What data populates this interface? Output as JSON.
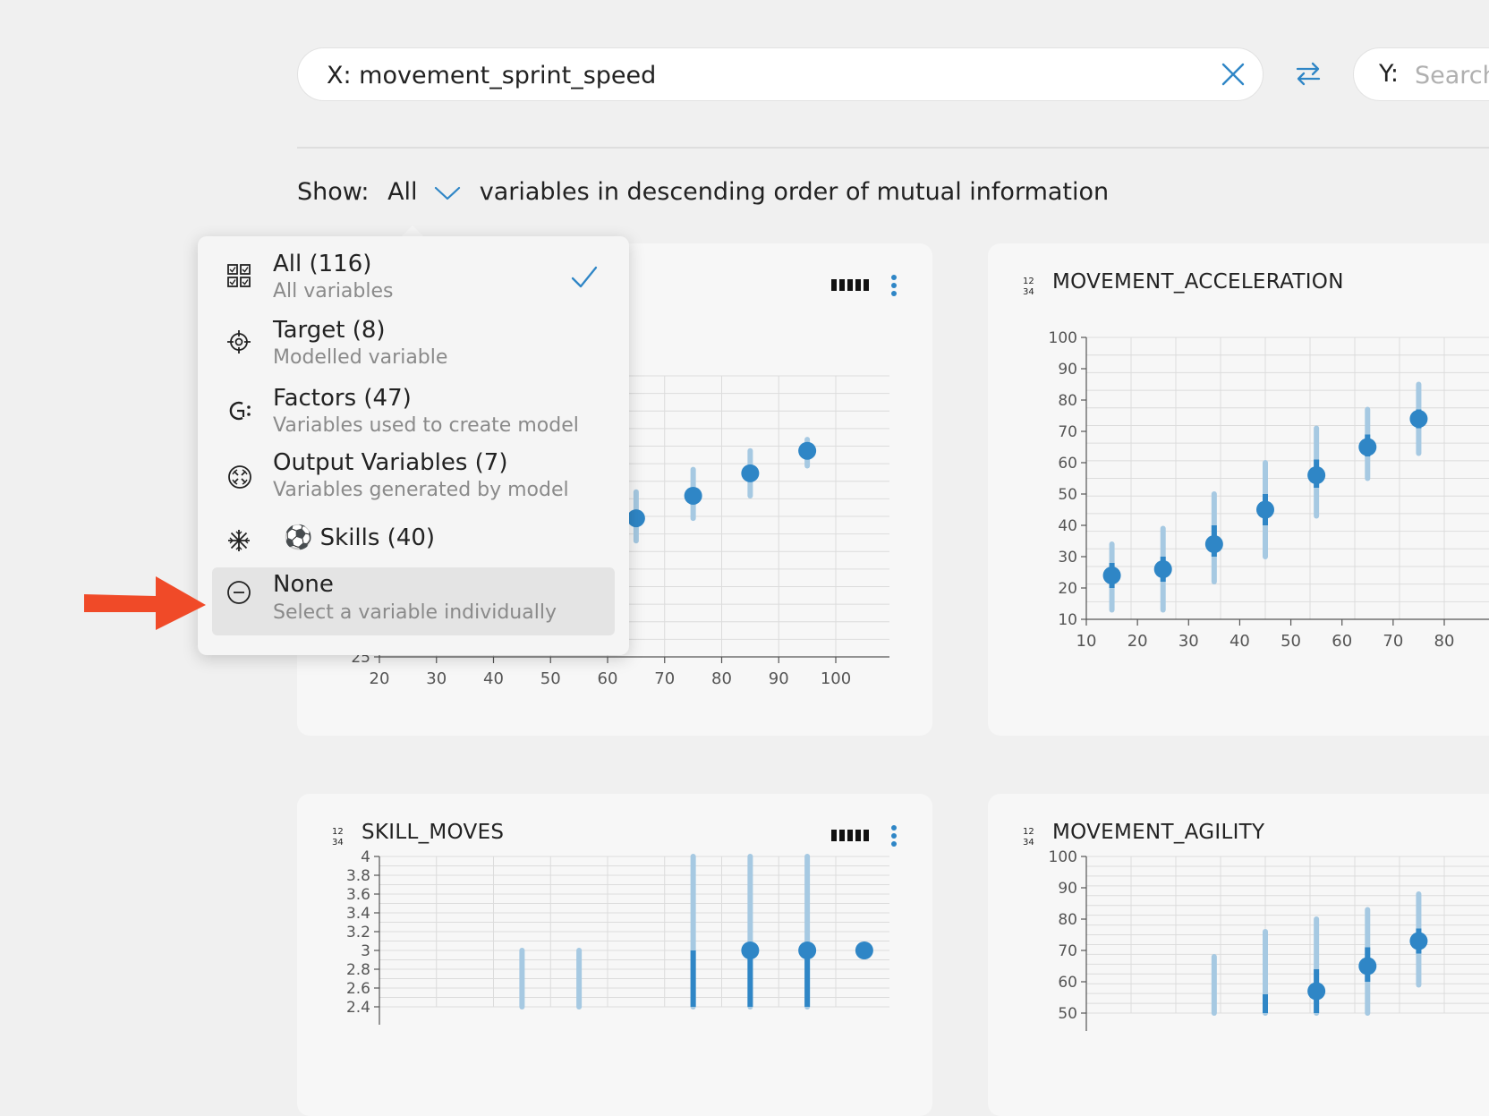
{
  "search": {
    "x_value": "X: movement_sprint_speed",
    "y_prefix": "Y:",
    "y_placeholder": "Search"
  },
  "show": {
    "label": "Show:",
    "selected": "All",
    "suffix": "variables in descending order of mutual information"
  },
  "dropdown": {
    "options": [
      {
        "title": "All (116)",
        "subtitle": "All variables",
        "icon": "grid-icon",
        "checked": true
      },
      {
        "title": "Target (8)",
        "subtitle": "Modelled variable",
        "icon": "target-icon",
        "checked": false
      },
      {
        "title": "Factors (47)",
        "subtitle": "Variables used to create model",
        "icon": "factors-icon",
        "checked": false
      },
      {
        "title": "Output Variables (7)",
        "subtitle": "Variables generated by model",
        "icon": "output-icon",
        "checked": false
      },
      {
        "title": "⚽ Skills (40)",
        "subtitle": "",
        "icon": "skills-icon",
        "checked": false
      },
      {
        "title": "None",
        "subtitle": "Select a variable individually",
        "icon": "minus-circle-icon",
        "checked": false
      }
    ]
  },
  "cards": [
    {
      "title": "",
      "icon": "numeric-icon"
    },
    {
      "title": "MOVEMENT_ACCELERATION",
      "icon": "numeric-icon"
    },
    {
      "title": "SKILL_MOVES",
      "icon": "numeric-icon"
    },
    {
      "title": "MOVEMENT_AGILITY",
      "icon": "numeric-icon"
    }
  ],
  "colors": {
    "accent": "#2f86c6",
    "interval": "#a6c9e2",
    "highlight_arrow": "#f04a28"
  },
  "chart_data": [
    {
      "type": "scatter",
      "title": "",
      "x_ticks": [
        "20",
        "30",
        "40",
        "50",
        "60",
        "70",
        "80",
        "90",
        "100"
      ],
      "y_ticks": [
        "25"
      ],
      "xlim": [
        20,
        100
      ],
      "ylim": [
        25,
        100
      ],
      "points": [
        {
          "x": 65,
          "y": 62,
          "lo": 56,
          "hi": 69,
          "q_lo": 60,
          "q_hi": 64
        },
        {
          "x": 75,
          "y": 68,
          "lo": 62,
          "hi": 75,
          "q_lo": 66,
          "q_hi": 70
        },
        {
          "x": 85,
          "y": 74,
          "lo": 68,
          "hi": 80,
          "q_lo": 72,
          "q_hi": 76
        },
        {
          "x": 95,
          "y": 80,
          "lo": 76,
          "hi": 83,
          "q_lo": 79,
          "q_hi": 81
        }
      ]
    },
    {
      "type": "scatter",
      "title": "MOVEMENT_ACCELERATION",
      "x_ticks": [
        "10",
        "20",
        "30",
        "40",
        "50",
        "60",
        "70",
        "80"
      ],
      "y_ticks": [
        "10",
        "20",
        "30",
        "40",
        "50",
        "60",
        "70",
        "80",
        "90",
        "100"
      ],
      "xlim": [
        10,
        80
      ],
      "ylim": [
        10,
        100
      ],
      "points": [
        {
          "x": 15,
          "y": 24,
          "lo": 13,
          "hi": 34,
          "q_lo": 20,
          "q_hi": 28
        },
        {
          "x": 25,
          "y": 26,
          "lo": 13,
          "hi": 39,
          "q_lo": 22,
          "q_hi": 30
        },
        {
          "x": 35,
          "y": 34,
          "lo": 22,
          "hi": 50,
          "q_lo": 30,
          "q_hi": 40
        },
        {
          "x": 45,
          "y": 45,
          "lo": 30,
          "hi": 60,
          "q_lo": 40,
          "q_hi": 50
        },
        {
          "x": 55,
          "y": 56,
          "lo": 43,
          "hi": 71,
          "q_lo": 52,
          "q_hi": 61
        },
        {
          "x": 65,
          "y": 65,
          "lo": 55,
          "hi": 77,
          "q_lo": 62,
          "q_hi": 69
        },
        {
          "x": 75,
          "y": 74,
          "lo": 63,
          "hi": 85,
          "q_lo": 71,
          "q_hi": 77
        }
      ]
    },
    {
      "type": "scatter",
      "title": "SKILL_MOVES",
      "x_ticks": [],
      "y_ticks": [
        "2.4",
        "2.6",
        "2.8",
        "3",
        "3.2",
        "3.4",
        "3.6",
        "3.8",
        "4"
      ],
      "xlim": [
        20,
        100
      ],
      "ylim": [
        2.4,
        4
      ],
      "points": [
        {
          "x": 45,
          "y": null,
          "lo": 2.4,
          "hi": 3.0
        },
        {
          "x": 55,
          "y": null,
          "lo": 2.4,
          "hi": 3.0
        },
        {
          "x": 75,
          "y": null,
          "lo": 2.4,
          "hi": 4.0,
          "q_lo": 2.4,
          "q_hi": 3.0
        },
        {
          "x": 85,
          "y": 3.0,
          "lo": 2.4,
          "hi": 4.0,
          "q_lo": 2.4,
          "q_hi": 3.0
        },
        {
          "x": 95,
          "y": 3.0,
          "lo": 2.4,
          "hi": 4.0,
          "q_lo": 2.4,
          "q_hi": 3.0
        },
        {
          "x": 105,
          "y": 3.0,
          "lo": 3.0,
          "hi": 3.0
        }
      ]
    },
    {
      "type": "scatter",
      "title": "MOVEMENT_AGILITY",
      "x_ticks": [],
      "y_ticks": [
        "50",
        "60",
        "70",
        "80",
        "90",
        "100"
      ],
      "xlim": [
        10,
        80
      ],
      "ylim": [
        50,
        100
      ],
      "points": [
        {
          "x": 35,
          "y": null,
          "lo": 50,
          "hi": 68
        },
        {
          "x": 45,
          "y": null,
          "lo": 50,
          "hi": 76,
          "q_lo": 50,
          "q_hi": 56
        },
        {
          "x": 55,
          "y": 57,
          "lo": 50,
          "hi": 80,
          "q_lo": 50,
          "q_hi": 64
        },
        {
          "x": 65,
          "y": 65,
          "lo": 50,
          "hi": 83,
          "q_lo": 60,
          "q_hi": 71
        },
        {
          "x": 75,
          "y": 73,
          "lo": 59,
          "hi": 88,
          "q_lo": 69,
          "q_hi": 77
        }
      ]
    }
  ]
}
